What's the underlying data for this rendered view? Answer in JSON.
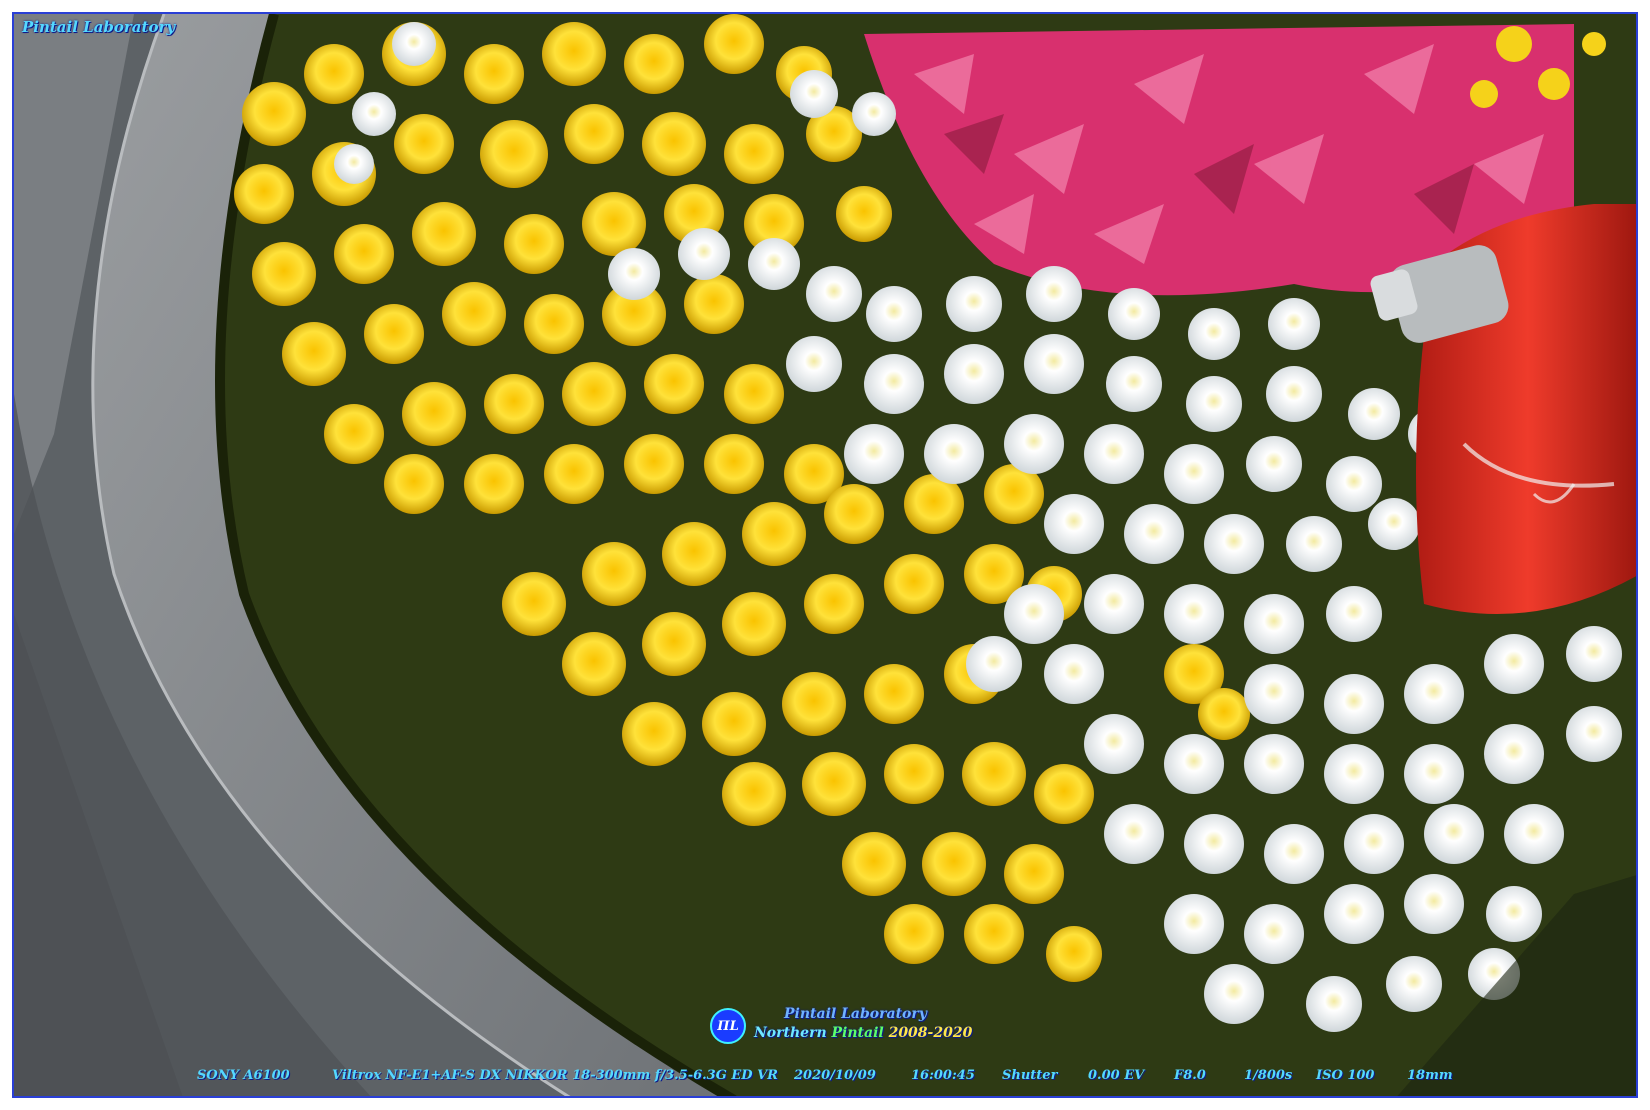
{
  "photo": {
    "watermark_top": "Pintail Laboratory",
    "logo_text": "ΠL",
    "brand_line1": "Pintail Laboratory",
    "brand_line2_a": "Northern ",
    "brand_line2_b": "Pintail",
    "brand_line2_c": " 2008-2020",
    "exif": {
      "camera": "SONY A6100",
      "lens": "Viltrox NF-E1+AF-S DX NIKKOR 18-300mm f/3.5-6.3G ED VR",
      "date": "2020/10/09",
      "time": "16:00:45",
      "mode": "Shutter",
      "ev": "0.00 EV",
      "aperture": "F8.0",
      "shutter": "1/800s",
      "iso": "ISO 100",
      "focal": "18mm"
    }
  },
  "colors": {
    "frame": "#2a3fd6",
    "watermark": "#55d8ff",
    "yellow_flower": "#f5d21a",
    "white_flower": "#f4f6f2",
    "pink_flower": "#d8306e",
    "hydrant": "#d62a1f",
    "stone": "#8a8d90"
  }
}
